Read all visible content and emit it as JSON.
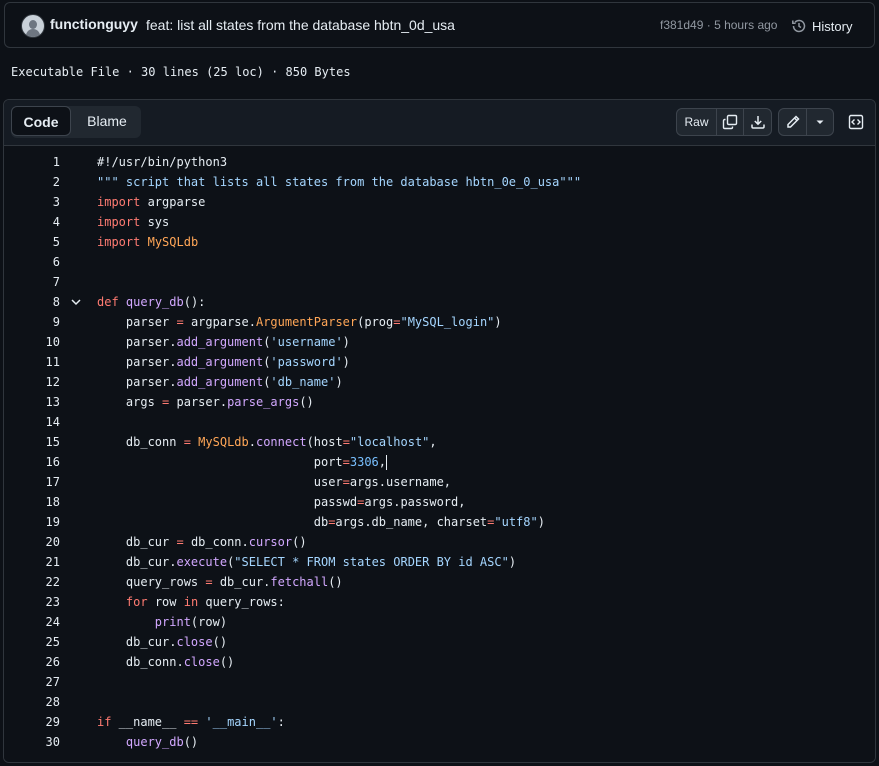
{
  "commit": {
    "author": "functionguyy",
    "message": "feat: list all states from the database hbtn_0d_usa",
    "sha": "f381d49",
    "separator": "·",
    "time": "5 hours ago",
    "history_label": "History"
  },
  "file_info": {
    "text": "Executable File · 30 lines (25 loc) · 850 Bytes"
  },
  "toolbar": {
    "code_tab": "Code",
    "blame_tab": "Blame",
    "raw_label": "Raw"
  },
  "icons": {
    "history": "history-icon",
    "copy": "copy-icon",
    "download": "download-icon",
    "edit": "pencil-icon",
    "more": "triangle-down-icon",
    "symbols": "code-square-icon",
    "fold": "chevron-down-icon"
  },
  "colors": {
    "background": "#0d1117",
    "keyword": "#ff7b72",
    "function": "#d2a8ff",
    "string": "#a5d6ff",
    "number": "#79c0ff",
    "class": "#ffa657"
  },
  "code_lines": [
    {
      "n": "1",
      "tokens": [
        [
          "",
          "#!/usr/bin/python3"
        ]
      ]
    },
    {
      "n": "2",
      "tokens": [
        [
          "str",
          "\"\"\" script that lists all states from the database hbtn_0e_0_usa\"\"\""
        ]
      ]
    },
    {
      "n": "3",
      "tokens": [
        [
          "kw",
          "import"
        ],
        [
          "",
          " argparse"
        ]
      ]
    },
    {
      "n": "4",
      "tokens": [
        [
          "kw",
          "import"
        ],
        [
          "",
          " sys"
        ]
      ]
    },
    {
      "n": "5",
      "tokens": [
        [
          "kw",
          "import"
        ],
        [
          "",
          " "
        ],
        [
          "cls",
          "MySQLdb"
        ]
      ]
    },
    {
      "n": "6",
      "tokens": []
    },
    {
      "n": "7",
      "tokens": []
    },
    {
      "n": "8",
      "fold": true,
      "tokens": [
        [
          "kw",
          "def"
        ],
        [
          "",
          " "
        ],
        [
          "fn",
          "query_db"
        ],
        [
          "",
          "():"
        ]
      ]
    },
    {
      "n": "9",
      "tokens": [
        [
          "",
          "    parser "
        ],
        [
          "op",
          "="
        ],
        [
          "",
          " argparse."
        ],
        [
          "cls",
          "ArgumentParser"
        ],
        [
          "",
          "(prog"
        ],
        [
          "op",
          "="
        ],
        [
          "str",
          "\"MySQL_login\""
        ],
        [
          "",
          ")"
        ]
      ]
    },
    {
      "n": "10",
      "tokens": [
        [
          "",
          "    parser."
        ],
        [
          "fn",
          "add_argument"
        ],
        [
          "",
          "("
        ],
        [
          "str",
          "'username'"
        ],
        [
          "",
          ")"
        ]
      ]
    },
    {
      "n": "11",
      "tokens": [
        [
          "",
          "    parser."
        ],
        [
          "fn",
          "add_argument"
        ],
        [
          "",
          "("
        ],
        [
          "str",
          "'password'"
        ],
        [
          "",
          ")"
        ]
      ]
    },
    {
      "n": "12",
      "tokens": [
        [
          "",
          "    parser."
        ],
        [
          "fn",
          "add_argument"
        ],
        [
          "",
          "("
        ],
        [
          "str",
          "'db_name'"
        ],
        [
          "",
          ")"
        ]
      ]
    },
    {
      "n": "13",
      "tokens": [
        [
          "",
          "    args "
        ],
        [
          "op",
          "="
        ],
        [
          "",
          " parser."
        ],
        [
          "fn",
          "parse_args"
        ],
        [
          "",
          "()"
        ]
      ]
    },
    {
      "n": "14",
      "tokens": []
    },
    {
      "n": "15",
      "tokens": [
        [
          "",
          "    db_conn "
        ],
        [
          "op",
          "="
        ],
        [
          "",
          " "
        ],
        [
          "cls",
          "MySQLdb"
        ],
        [
          "",
          "."
        ],
        [
          "fn",
          "connect"
        ],
        [
          "",
          "(host"
        ],
        [
          "op",
          "="
        ],
        [
          "str",
          "\"localhost\""
        ],
        [
          "",
          ","
        ]
      ]
    },
    {
      "n": "16",
      "cursor": true,
      "tokens": [
        [
          "",
          "                              port"
        ],
        [
          "op",
          "="
        ],
        [
          "num",
          "3306"
        ],
        [
          "",
          ","
        ]
      ]
    },
    {
      "n": "17",
      "tokens": [
        [
          "",
          "                              user"
        ],
        [
          "op",
          "="
        ],
        [
          "",
          "args.username,"
        ]
      ]
    },
    {
      "n": "18",
      "tokens": [
        [
          "",
          "                              passwd"
        ],
        [
          "op",
          "="
        ],
        [
          "",
          "args.password,"
        ]
      ]
    },
    {
      "n": "19",
      "tokens": [
        [
          "",
          "                              db"
        ],
        [
          "op",
          "="
        ],
        [
          "",
          "args.db_name, charset"
        ],
        [
          "op",
          "="
        ],
        [
          "str",
          "\"utf8\""
        ],
        [
          "",
          ")"
        ]
      ]
    },
    {
      "n": "20",
      "tokens": [
        [
          "",
          "    db_cur "
        ],
        [
          "op",
          "="
        ],
        [
          "",
          " db_conn."
        ],
        [
          "fn",
          "cursor"
        ],
        [
          "",
          "()"
        ]
      ]
    },
    {
      "n": "21",
      "tokens": [
        [
          "",
          "    db_cur."
        ],
        [
          "fn",
          "execute"
        ],
        [
          "",
          "("
        ],
        [
          "str",
          "\"SELECT * FROM states ORDER BY id ASC\""
        ],
        [
          "",
          ")"
        ]
      ]
    },
    {
      "n": "22",
      "tokens": [
        [
          "",
          "    query_rows "
        ],
        [
          "op",
          "="
        ],
        [
          "",
          " db_cur."
        ],
        [
          "fn",
          "fetchall"
        ],
        [
          "",
          "()"
        ]
      ]
    },
    {
      "n": "23",
      "tokens": [
        [
          "",
          "    "
        ],
        [
          "kw",
          "for"
        ],
        [
          "",
          " row "
        ],
        [
          "kw",
          "in"
        ],
        [
          "",
          " query_rows:"
        ]
      ]
    },
    {
      "n": "24",
      "tokens": [
        [
          "",
          "        "
        ],
        [
          "fn",
          "print"
        ],
        [
          "",
          "(row)"
        ]
      ]
    },
    {
      "n": "25",
      "tokens": [
        [
          "",
          "    db_cur."
        ],
        [
          "fn",
          "close"
        ],
        [
          "",
          "()"
        ]
      ]
    },
    {
      "n": "26",
      "tokens": [
        [
          "",
          "    db_conn."
        ],
        [
          "fn",
          "close"
        ],
        [
          "",
          "()"
        ]
      ]
    },
    {
      "n": "27",
      "tokens": []
    },
    {
      "n": "28",
      "tokens": []
    },
    {
      "n": "29",
      "tokens": [
        [
          "kw",
          "if"
        ],
        [
          "",
          " __name__ "
        ],
        [
          "op",
          "=="
        ],
        [
          "",
          " "
        ],
        [
          "str",
          "'__main__'"
        ],
        [
          "",
          ":"
        ]
      ]
    },
    {
      "n": "30",
      "tokens": [
        [
          "",
          "    "
        ],
        [
          "fn",
          "query_db"
        ],
        [
          "",
          "()"
        ]
      ]
    }
  ]
}
